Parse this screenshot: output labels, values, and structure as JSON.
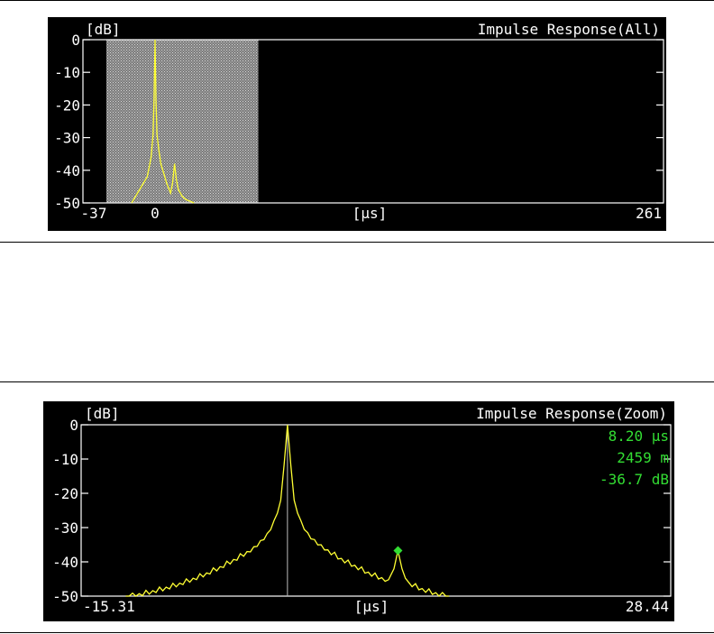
{
  "chart_data": [
    {
      "type": "line",
      "title": "Impulse Response(All)",
      "ylabel": "[dB]",
      "xlabel": "[µs]",
      "xlim": [
        -37,
        261
      ],
      "ylim": [
        -50,
        0
      ],
      "y_ticks": [
        0,
        -10,
        -20,
        -30,
        -40,
        -50
      ],
      "x_tick_labels": [
        "-37",
        "0",
        "261"
      ],
      "zoom_window": [
        -25,
        53
      ],
      "series": [
        {
          "color": "#ffff33",
          "x": [
            -12,
            -10,
            -8,
            -6,
            -4,
            -3,
            -2,
            -1,
            -0.5,
            0,
            0.5,
            1,
            2,
            3,
            4,
            5,
            6,
            8,
            9,
            10,
            11,
            12,
            13,
            14,
            16,
            18,
            20
          ],
          "y": [
            -50,
            -48,
            -46,
            -44,
            -42,
            -39,
            -36,
            -29,
            -18,
            0,
            -18,
            -29,
            -34,
            -38,
            -40,
            -42,
            -44,
            -47,
            -44,
            -38,
            -43,
            -46,
            -47,
            -48,
            -49,
            -49.5,
            -50
          ]
        }
      ]
    },
    {
      "type": "line",
      "title": "Impulse Response(Zoom)",
      "ylabel": "[dB]",
      "xlabel": "[µs]",
      "xlim": [
        -15.31,
        28.44
      ],
      "ylim": [
        -50,
        0
      ],
      "y_ticks": [
        0,
        -10,
        -20,
        -30,
        -40,
        -50
      ],
      "x_tick_labels": [
        "-15.31",
        "28.44"
      ],
      "cursor_x": 0,
      "marker": {
        "x": 8.2,
        "y": -36.7,
        "color": "#33dd33"
      },
      "readout": [
        "8.20 µs",
        "2459 m",
        "-36.7 dB"
      ],
      "series": [
        {
          "color": "#ffff33",
          "x": [
            -12,
            -11,
            -10,
            -9,
            -8,
            -7,
            -6,
            -5,
            -4,
            -3,
            -2.5,
            -2,
            -1.5,
            -1,
            -0.5,
            0,
            0.5,
            1,
            1.5,
            2,
            2.5,
            3,
            4,
            5,
            6,
            7,
            7.5,
            7.9,
            8.2,
            8.5,
            9,
            10,
            11,
            12
          ],
          "y": [
            -50,
            -49.3,
            -48.4,
            -47.4,
            -46.2,
            -44.8,
            -43.2,
            -41.4,
            -39.3,
            -37,
            -35.6,
            -33.8,
            -31.7,
            -28,
            -22,
            0,
            -22,
            -28,
            -31.5,
            -33.5,
            -35,
            -36.5,
            -39,
            -41,
            -43,
            -44.6,
            -45.2,
            -42,
            -36.7,
            -42,
            -46,
            -47.8,
            -49,
            -50
          ]
        }
      ]
    }
  ]
}
